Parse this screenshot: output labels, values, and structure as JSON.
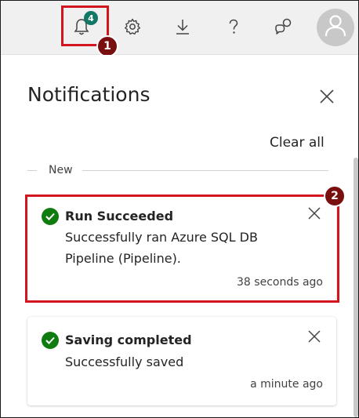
{
  "topbar": {
    "notification_count": "4",
    "icons": [
      "bell-icon",
      "gear-icon",
      "download-icon",
      "help-icon",
      "feedback-icon",
      "avatar-icon"
    ]
  },
  "annotations": {
    "marker1": "1",
    "marker2": "2",
    "color": "#d3161e"
  },
  "panel": {
    "title": "Notifications",
    "clear_all": "Clear all",
    "section_label": "New",
    "notifications": [
      {
        "title": "Run Succeeded",
        "message": "Successfully ran Azure SQL DB Pipeline (Pipeline).",
        "time": "38 seconds ago"
      },
      {
        "title": "Saving completed",
        "message": "Successfully saved",
        "time": "a minute ago"
      }
    ]
  },
  "colors": {
    "success": "#107c10",
    "badge": "#117865",
    "marker": "#7a0f0f"
  }
}
